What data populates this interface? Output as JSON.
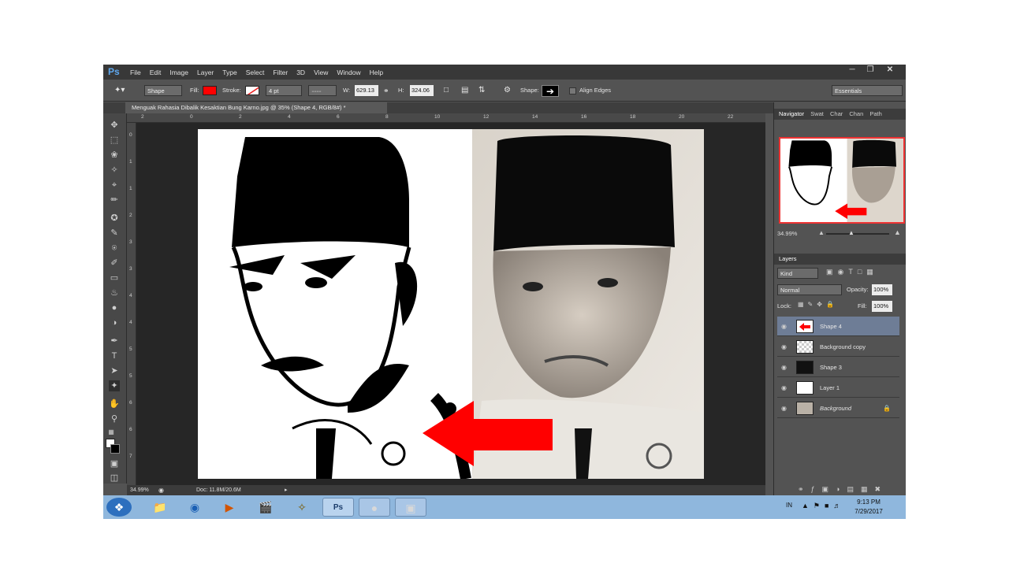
{
  "app": {
    "logo": "Ps",
    "menus": [
      "File",
      "Edit",
      "Image",
      "Layer",
      "Type",
      "Select",
      "Filter",
      "3D",
      "View",
      "Window",
      "Help"
    ]
  },
  "options": {
    "mode": "Shape",
    "fill_label": "Fill:",
    "stroke_label": "Stroke:",
    "stroke_width": "4 pt",
    "w_label": "W:",
    "w_value": "629.13",
    "h_label": "H:",
    "h_value": "324.06",
    "shape_label": "Shape:",
    "align_edges": "Align Edges",
    "workspace": "Essentials",
    "fill_color": "#ff0000"
  },
  "document": {
    "tab_title": "Menguak Rahasia Dibalik Kesaktian Bung Karno.jpg @ 35% (Shape 4, RGB/8#) *",
    "zoom": "34.99%",
    "doc_size": "Doc: 11.8M/20.6M"
  },
  "ruler": {
    "top": [
      "2",
      "0",
      "2",
      "4",
      "6",
      "8",
      "10",
      "12",
      "14",
      "16",
      "18",
      "20",
      "22"
    ],
    "left": [
      "0",
      "1",
      "1",
      "2",
      "3",
      "3",
      "4",
      "4",
      "5",
      "5",
      "6",
      "6",
      "7"
    ]
  },
  "navigator": {
    "tabs": [
      "Navigator",
      "Swat",
      "Char",
      "Chan",
      "Path"
    ],
    "zoom": "34.99%"
  },
  "layers_panel": {
    "title": "Layers",
    "filter": "Kind",
    "blend_mode": "Normal",
    "opacity_label": "Opacity:",
    "opacity": "100%",
    "lock_label": "Lock:",
    "fill_label": "Fill:",
    "fill": "100%",
    "layers": [
      {
        "name": "Shape 4"
      },
      {
        "name": "Background copy"
      },
      {
        "name": "Shape 3"
      },
      {
        "name": "Layer 1"
      },
      {
        "name": "Background"
      }
    ]
  },
  "taskbar": {
    "lang": "IN",
    "time": "9:13 PM",
    "date": "7/29/2017"
  }
}
